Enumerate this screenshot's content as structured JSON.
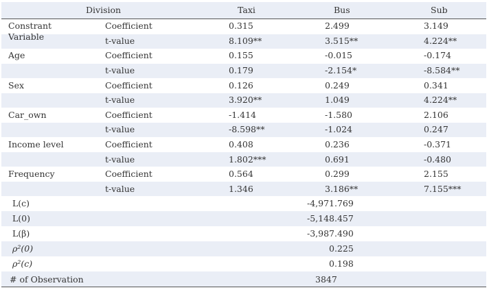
{
  "headers": [
    "Division",
    "Taxi",
    "Bus",
    "Sub"
  ],
  "rows": [
    {
      "variable": [
        "Constrant",
        "Variable"
      ],
      "coef_label": "Coefficient",
      "tval_label": "t-value",
      "coef": [
        "0.315",
        "2.499",
        "3.149"
      ],
      "tval": [
        "8.109**",
        "3.515**",
        "4.224**"
      ]
    },
    {
      "variable": [
        "Age"
      ],
      "coef_label": "Coefficient",
      "tval_label": "t-value",
      "coef": [
        "0.155",
        "-0.015",
        "-0.174"
      ],
      "tval": [
        "0.179",
        "-2.154*",
        "-8.584**"
      ]
    },
    {
      "variable": [
        "Sex"
      ],
      "coef_label": "Coefficient",
      "tval_label": "t-value",
      "coef": [
        "0.126",
        "0.249",
        "0.341"
      ],
      "tval": [
        "3.920**",
        "1.049",
        "4.224**"
      ]
    },
    {
      "variable": [
        "Car_own"
      ],
      "coef_label": "Coefficient",
      "tval_label": "t-value",
      "coef": [
        "-1.414",
        "-1.580",
        "2.106"
      ],
      "tval": [
        "-8.598**",
        "-1.024",
        "0.247"
      ]
    },
    {
      "variable": [
        "Income level"
      ],
      "coef_label": "Coefficient",
      "tval_label": "t-value",
      "coef": [
        "0.408",
        "0.236",
        "-0.371"
      ],
      "tval": [
        "1.802***",
        "0.691",
        "-0.480"
      ]
    },
    {
      "variable": [
        "Frequency"
      ],
      "coef_label": "Coefficient",
      "tval_label": "t-value",
      "coef": [
        "0.564",
        "0.299",
        "2.155"
      ],
      "tval": [
        "1.346",
        "3.186**",
        "7.155***"
      ]
    }
  ],
  "summary": [
    {
      "label": "L(c)",
      "value": "-4,971.769"
    },
    {
      "label": "L(0)",
      "value": "-5,148.457"
    },
    {
      "label": "L(β)",
      "value": "-3,987.490"
    },
    {
      "label": "ρ²(0)",
      "value": "0.225"
    },
    {
      "label": "ρ²(c)",
      "value": "0.198"
    },
    {
      "label": "# of Observation",
      "value": "3847"
    }
  ]
}
